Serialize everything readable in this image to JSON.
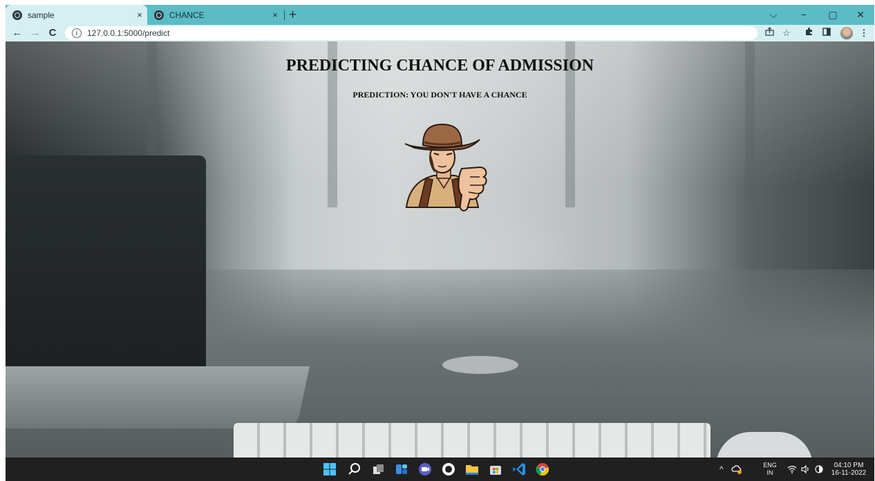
{
  "browser": {
    "tabs": [
      {
        "label": "sample",
        "active": true,
        "close": "×"
      },
      {
        "label": "CHANCE",
        "active": false,
        "close": "×"
      }
    ],
    "new_tab": "+",
    "url": "127.0.0.1:5000/predict",
    "nav": {
      "back": "←",
      "forward": "→",
      "reload": "C"
    },
    "window": {
      "tab_search": "⌵",
      "minimize": "−",
      "maximize": "▢",
      "close": "✕"
    },
    "toolbar_icons": [
      "share-icon",
      "star-icon",
      "extensions-icon",
      "sidebar-icon",
      "profile-avatar",
      "menu-icon"
    ]
  },
  "page": {
    "title": "PREDICTING CHANCE OF ADMISSION",
    "prediction": "PREDICTION: YOU DON'T HAVE A CHANCE"
  },
  "taskbar": {
    "apps": [
      "windows-start-icon",
      "search-icon",
      "task-view-icon",
      "widgets-icon",
      "chat-icon",
      "github-desktop-icon",
      "file-explorer-icon",
      "microsoft-store-icon",
      "vscode-icon",
      "chrome-icon"
    ],
    "language_top": "ENG",
    "language_bottom": "IN",
    "time": "04:10 PM",
    "date": "16-11-2022"
  },
  "colors": {
    "tab_strip": "#5bbcc5",
    "toolbar": "#d6eff1",
    "taskbar": "#202020"
  }
}
